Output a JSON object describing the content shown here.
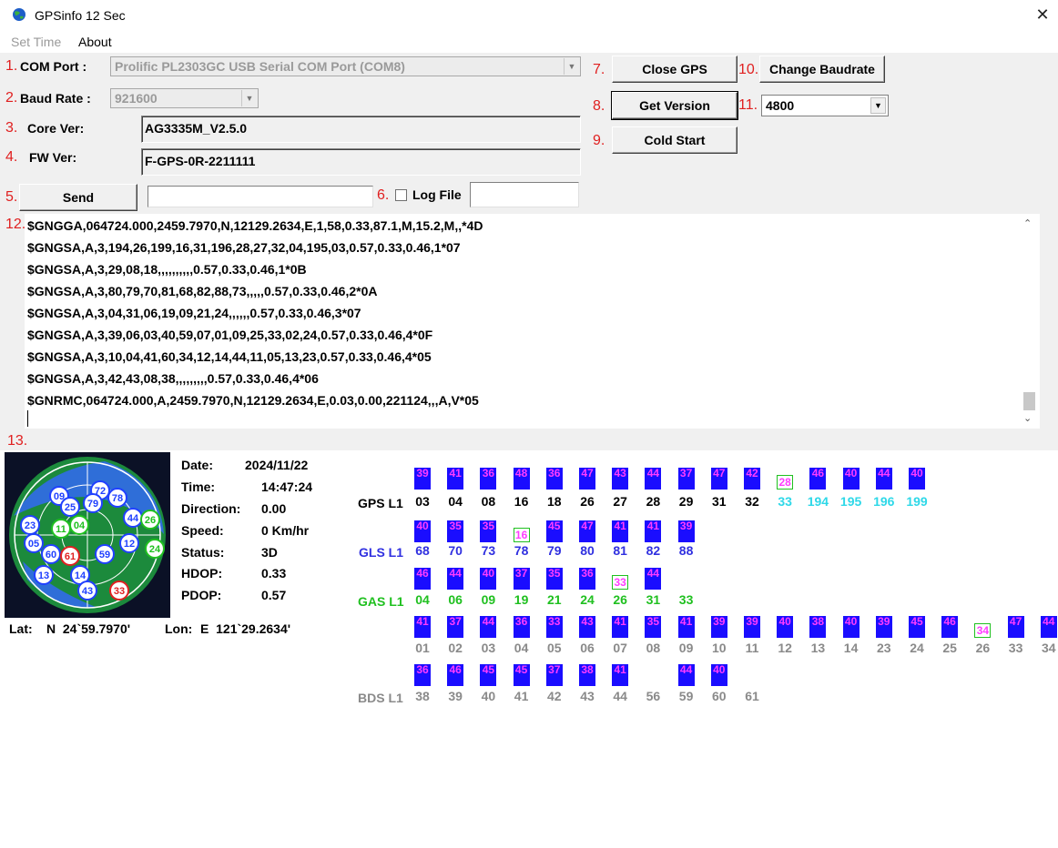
{
  "window": {
    "title": "GPSinfo  12 Sec",
    "close_icon": "close-icon",
    "app_icon": "globe-icon"
  },
  "menu": [
    {
      "label": "Set Time",
      "enabled": false
    },
    {
      "label": "About",
      "enabled": true
    }
  ],
  "controls": {
    "com_port": {
      "num": "1.",
      "label": "COM Port :",
      "value": "Prolific PL2303GC USB Serial COM Port (COM8)"
    },
    "baud_rate": {
      "num": "2.",
      "label": "Baud Rate :",
      "value": "921600"
    },
    "core_ver": {
      "num": "3.",
      "label": "Core Ver:",
      "value": "AG3335M_V2.5.0"
    },
    "fw_ver": {
      "num": "4.",
      "label": "FW Ver:",
      "value": "F-GPS-0R-2211111"
    },
    "send": {
      "num": "5.",
      "label": "Send",
      "input_value": ""
    },
    "log_file": {
      "num": "6.",
      "label": "Log File",
      "checked": false,
      "input_value": ""
    },
    "close_gps": {
      "num": "7.",
      "label": "Close GPS"
    },
    "get_version": {
      "num": "8.",
      "label": "Get Version"
    },
    "cold_start": {
      "num": "9.",
      "label": "Cold Start"
    },
    "change_baudrate": {
      "num": "10.",
      "label": "Change Baudrate"
    },
    "baud_select": {
      "num": "11.",
      "value": "4800"
    },
    "log_num": "12.",
    "section13_num": "13."
  },
  "nmea_log": [
    "$GNGGA,064724.000,2459.7970,N,12129.2634,E,1,58,0.33,87.1,M,15.2,M,,*4D",
    "$GNGSA,A,3,194,26,199,16,31,196,28,27,32,04,195,03,0.57,0.33,0.46,1*07",
    "$GNGSA,A,3,29,08,18,,,,,,,,,,0.57,0.33,0.46,1*0B",
    "$GNGSA,A,3,80,79,70,81,68,82,88,73,,,,,0.57,0.33,0.46,2*0A",
    "$GNGSA,A,3,04,31,06,19,09,21,24,,,,,,0.57,0.33,0.46,3*07",
    "$GNGSA,A,3,39,06,03,40,59,07,01,09,25,33,02,24,0.57,0.33,0.46,4*0F",
    "$GNGSA,A,3,10,04,41,60,34,12,14,44,11,05,13,23,0.57,0.33,0.46,4*05",
    "$GNGSA,A,3,42,43,08,38,,,,,,,,,0.57,0.33,0.46,4*06",
    "$GNRMC,064724.000,A,2459.7970,N,12129.2634,E,0.03,0.00,221124,,,A,V*05"
  ],
  "status": {
    "date": {
      "label": "Date:",
      "value": "2024/11/22"
    },
    "time": {
      "label": "Time:",
      "value": "14:47:24"
    },
    "direction": {
      "label": "Direction:",
      "value": "0.00"
    },
    "speed": {
      "label": "Speed:",
      "value": "0 Km/hr"
    },
    "status": {
      "label": "Status:",
      "value": "3D"
    },
    "hdop": {
      "label": "HDOP:",
      "value": "0.33"
    },
    "pdop": {
      "label": "PDOP:",
      "value": "0.57"
    },
    "lat_label": "Lat:",
    "lat_value": "N  24`59.7970'",
    "lon_label": "Lon:",
    "lon_value": "E  121`29.2634'"
  },
  "colors": {
    "box": "#1a0dff",
    "snr_text": "#ff3cff",
    "gps_label": "#000000",
    "gls_label": "#3030e0",
    "gas_label": "#20c020",
    "bds_label": "#9a9a9a",
    "tracked_prn_gps": "#000000",
    "untracked_prn": "#2ed8e8",
    "number_red": "#e02020"
  },
  "constellations": [
    {
      "label": "GPS L1",
      "prn_color": "#000000",
      "sats": [
        {
          "prn": "03",
          "snr": "39",
          "used": true
        },
        {
          "prn": "04",
          "snr": "41",
          "used": true
        },
        {
          "prn": "08",
          "snr": "36",
          "used": true
        },
        {
          "prn": "16",
          "snr": "48",
          "used": true
        },
        {
          "prn": "18",
          "snr": "36",
          "used": true
        },
        {
          "prn": "26",
          "snr": "47",
          "used": true
        },
        {
          "prn": "27",
          "snr": "43",
          "used": true
        },
        {
          "prn": "28",
          "snr": "44",
          "used": true
        },
        {
          "prn": "29",
          "snr": "37",
          "used": true
        },
        {
          "prn": "31",
          "snr": "47",
          "used": true
        },
        {
          "prn": "32",
          "snr": "42",
          "used": true
        },
        {
          "prn": "33",
          "snr": "28",
          "used": false,
          "prn_color": "#2ed8e8"
        },
        {
          "prn": "194",
          "snr": "46",
          "used": true,
          "prn_color": "#2ed8e8"
        },
        {
          "prn": "195",
          "snr": "40",
          "used": true,
          "prn_color": "#2ed8e8"
        },
        {
          "prn": "196",
          "snr": "44",
          "used": true,
          "prn_color": "#2ed8e8"
        },
        {
          "prn": "199",
          "snr": "40",
          "used": true,
          "prn_color": "#2ed8e8"
        }
      ]
    },
    {
      "label": "GLS L1",
      "prn_color": "#3030e0",
      "sats": [
        {
          "prn": "68",
          "snr": "40",
          "used": true
        },
        {
          "prn": "70",
          "snr": "35",
          "used": true
        },
        {
          "prn": "73",
          "snr": "35",
          "used": true
        },
        {
          "prn": "78",
          "snr": "16",
          "used": false
        },
        {
          "prn": "79",
          "snr": "45",
          "used": true
        },
        {
          "prn": "80",
          "snr": "47",
          "used": true
        },
        {
          "prn": "81",
          "snr": "41",
          "used": true
        },
        {
          "prn": "82",
          "snr": "41",
          "used": true
        },
        {
          "prn": "88",
          "snr": "39",
          "used": true
        }
      ]
    },
    {
      "label": "GAS L1",
      "prn_color": "#20c020",
      "sats": [
        {
          "prn": "04",
          "snr": "46",
          "used": true
        },
        {
          "prn": "06",
          "snr": "44",
          "used": true
        },
        {
          "prn": "09",
          "snr": "40",
          "used": true
        },
        {
          "prn": "19",
          "snr": "37",
          "used": true
        },
        {
          "prn": "21",
          "snr": "35",
          "used": true
        },
        {
          "prn": "24",
          "snr": "36",
          "used": true
        },
        {
          "prn": "26",
          "snr": "33",
          "used": false
        },
        {
          "prn": "31",
          "snr": "44",
          "used": true
        },
        {
          "prn": "33",
          "snr": "",
          "used": false
        }
      ]
    },
    {
      "label": "",
      "prn_color": "#8a8a8a",
      "sats": [
        {
          "prn": "01",
          "snr": "41",
          "used": true
        },
        {
          "prn": "02",
          "snr": "37",
          "used": true
        },
        {
          "prn": "03",
          "snr": "44",
          "used": true
        },
        {
          "prn": "04",
          "snr": "36",
          "used": true
        },
        {
          "prn": "05",
          "snr": "33",
          "used": true
        },
        {
          "prn": "06",
          "snr": "43",
          "used": true
        },
        {
          "prn": "07",
          "snr": "41",
          "used": true
        },
        {
          "prn": "08",
          "snr": "35",
          "used": true
        },
        {
          "prn": "09",
          "snr": "41",
          "used": true
        },
        {
          "prn": "10",
          "snr": "39",
          "used": true
        },
        {
          "prn": "11",
          "snr": "39",
          "used": true
        },
        {
          "prn": "12",
          "snr": "40",
          "used": true
        },
        {
          "prn": "13",
          "snr": "38",
          "used": true
        },
        {
          "prn": "14",
          "snr": "40",
          "used": true
        },
        {
          "prn": "23",
          "snr": "39",
          "used": true
        },
        {
          "prn": "24",
          "snr": "45",
          "used": true
        },
        {
          "prn": "25",
          "snr": "46",
          "used": true
        },
        {
          "prn": "26",
          "snr": "34",
          "used": false
        },
        {
          "prn": "33",
          "snr": "47",
          "used": true
        },
        {
          "prn": "34",
          "snr": "44",
          "used": true
        }
      ]
    },
    {
      "label": "BDS L1",
      "prn_color": "#8a8a8a",
      "sats": [
        {
          "prn": "38",
          "snr": "36",
          "used": true
        },
        {
          "prn": "39",
          "snr": "46",
          "used": true
        },
        {
          "prn": "40",
          "snr": "45",
          "used": true
        },
        {
          "prn": "41",
          "snr": "45",
          "used": true
        },
        {
          "prn": "42",
          "snr": "37",
          "used": true
        },
        {
          "prn": "43",
          "snr": "38",
          "used": true
        },
        {
          "prn": "44",
          "snr": "41",
          "used": true
        },
        {
          "prn": "56",
          "snr": "",
          "used": false
        },
        {
          "prn": "59",
          "snr": "44",
          "used": true
        },
        {
          "prn": "60",
          "snr": "40",
          "used": true
        },
        {
          "prn": "61",
          "snr": "",
          "used": false
        }
      ]
    }
  ],
  "skyplot": {
    "sats": [
      {
        "id": "09",
        "c": "#2040ff"
      },
      {
        "id": "72",
        "c": "#2040ff"
      },
      {
        "id": "78",
        "c": "#2040ff"
      },
      {
        "id": "25",
        "c": "#2040ff"
      },
      {
        "id": "79",
        "c": "#2040ff"
      },
      {
        "id": "44",
        "c": "#2040ff"
      },
      {
        "id": "23",
        "c": "#2040ff"
      },
      {
        "id": "11",
        "c": "#20c020"
      },
      {
        "id": "04",
        "c": "#20c020"
      },
      {
        "id": "05",
        "c": "#2040ff"
      },
      {
        "id": "60",
        "c": "#2040ff"
      },
      {
        "id": "61",
        "c": "#e02020"
      },
      {
        "id": "59",
        "c": "#2040ff"
      },
      {
        "id": "12",
        "c": "#2040ff"
      },
      {
        "id": "26",
        "c": "#20c020"
      },
      {
        "id": "24",
        "c": "#20c020"
      },
      {
        "id": "13",
        "c": "#2040ff"
      },
      {
        "id": "14",
        "c": "#2040ff"
      },
      {
        "id": "43",
        "c": "#2040ff"
      },
      {
        "id": "33",
        "c": "#e02020"
      }
    ]
  }
}
